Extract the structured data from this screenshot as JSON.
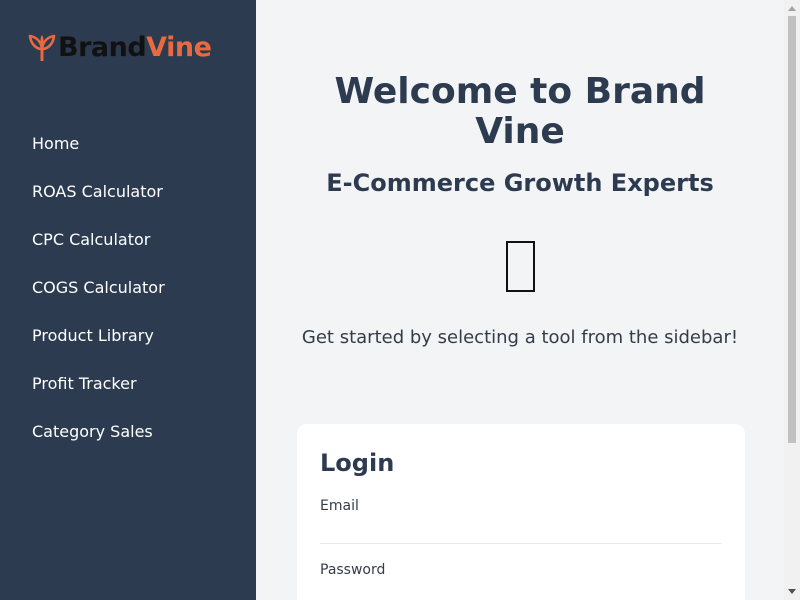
{
  "brand": {
    "name_part1": "Brand",
    "name_part2": "Vine",
    "icon": "leaf-logo-icon",
    "colors": {
      "dark": "#111111",
      "accent": "#e86a3e"
    }
  },
  "sidebar": {
    "background": "#2d3b50",
    "items": [
      {
        "label": "Home"
      },
      {
        "label": "ROAS Calculator"
      },
      {
        "label": "CPC Calculator"
      },
      {
        "label": "COGS Calculator"
      },
      {
        "label": "Product Library"
      },
      {
        "label": "Profit Tracker"
      },
      {
        "label": "Category Sales"
      }
    ]
  },
  "main": {
    "title": "Welcome to Brand Vine",
    "subtitle": "E-Commerce Growth Experts",
    "emoji_icon": "missing-glyph-icon",
    "tagline": "Get started by selecting a tool from the sidebar!"
  },
  "login": {
    "title": "Login",
    "email_label": "Email",
    "email_value": "",
    "password_label": "Password",
    "password_value": ""
  }
}
